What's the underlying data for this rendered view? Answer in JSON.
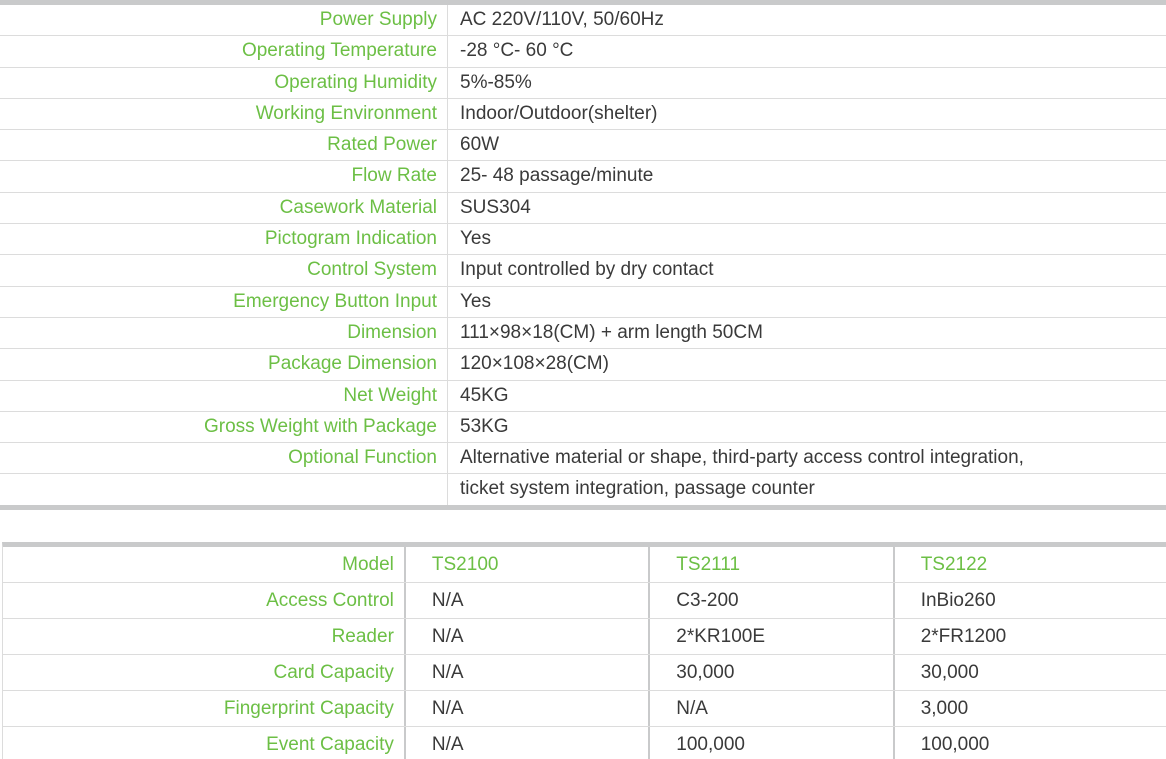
{
  "specs": [
    {
      "label": "Power Supply",
      "value": "AC 220V/110V, 50/60Hz"
    },
    {
      "label": "Operating Temperature",
      "value": "-28 °C- 60 °C"
    },
    {
      "label": "Operating Humidity",
      "value": "5%-85%"
    },
    {
      "label": "Working Environment",
      "value": "Indoor/Outdoor(shelter)"
    },
    {
      "label": "Rated Power",
      "value": "60W"
    },
    {
      "label": "Flow Rate",
      "value": "25- 48 passage/minute"
    },
    {
      "label": "Casework Material",
      "value": "SUS304"
    },
    {
      "label": "Pictogram Indication",
      "value": "Yes"
    },
    {
      "label": "Control System",
      "value": "Input controlled by dry contact"
    },
    {
      "label": "Emergency Button Input",
      "value": "Yes"
    },
    {
      "label": "Dimension",
      "value": "111×98×18(CM) + arm length 50CM"
    },
    {
      "label": "Package Dimension",
      "value": "120×108×28(CM)"
    },
    {
      "label": "Net Weight",
      "value": "45KG"
    },
    {
      "label": "Gross Weight with Package",
      "value": "53KG"
    },
    {
      "label": "Optional Function",
      "value": "Alternative material or shape, third-party access control integration,"
    },
    {
      "label": "",
      "value": "ticket system integration, passage counter"
    }
  ],
  "models": {
    "header": {
      "label": "Model",
      "cells": [
        "TS2100",
        "TS2111",
        "TS2122"
      ]
    },
    "rows": [
      {
        "label": "Access Control",
        "cells": [
          "N/A",
          "C3-200",
          "InBio260"
        ]
      },
      {
        "label": "Reader",
        "cells": [
          "N/A",
          "2*KR100E",
          "2*FR1200"
        ]
      },
      {
        "label": "Card Capacity",
        "cells": [
          "N/A",
          "30,000",
          "30,000"
        ]
      },
      {
        "label": "Fingerprint Capacity",
        "cells": [
          "N/A",
          "N/A",
          "3,000"
        ]
      },
      {
        "label": "Event Capacity",
        "cells": [
          "N/A",
          "100,000",
          "100,000"
        ]
      }
    ]
  },
  "colors": {
    "label_green": "#6cbf45",
    "value_text": "#3a3a3a",
    "rule_gray": "#c9cacb"
  }
}
